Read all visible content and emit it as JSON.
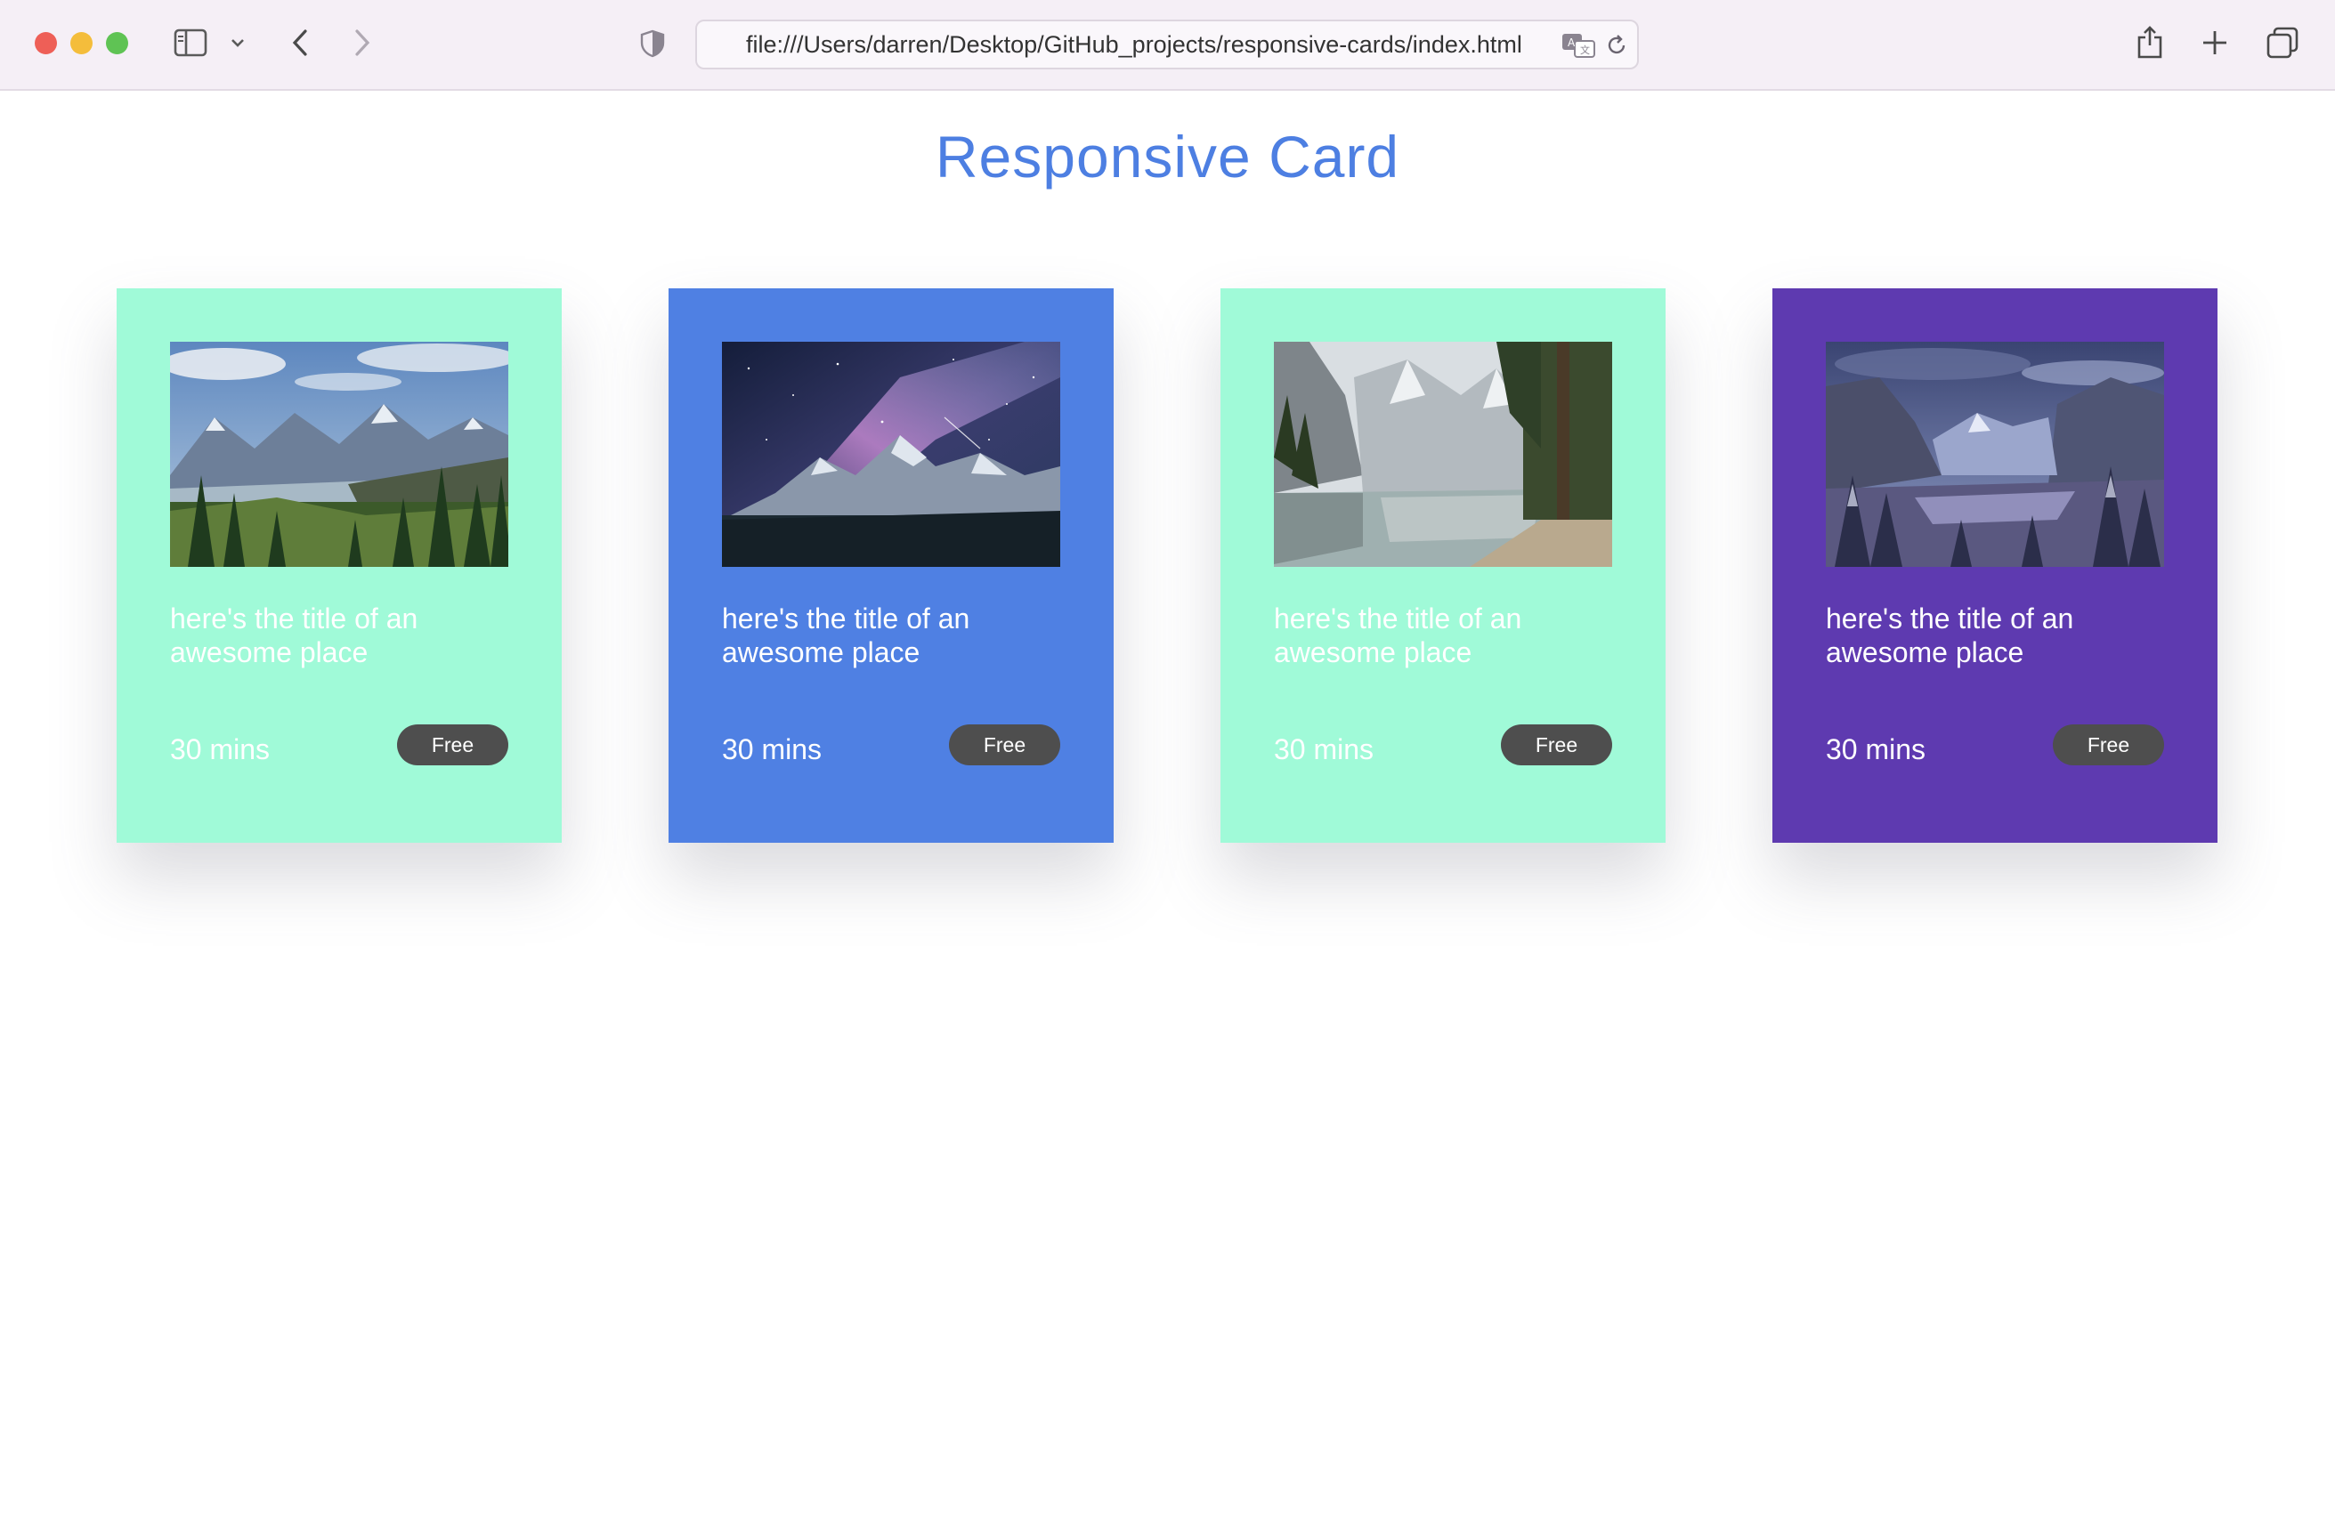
{
  "browser": {
    "url": "file:///Users/darren/Desktop/GitHub_projects/responsive-cards/index.html",
    "icons": [
      "close-window-icon",
      "minimize-window-icon",
      "maximize-window-icon",
      "sidebar-icon",
      "chevron-down-icon",
      "back-icon",
      "forward-icon",
      "privacy-shield-icon",
      "translate-icon",
      "reload-icon",
      "share-icon",
      "new-tab-icon",
      "tab-overview-icon"
    ]
  },
  "page": {
    "title": "Responsive Card"
  },
  "cards": [
    {
      "title": "here's the title of an awesome place",
      "time": "30 mins",
      "badge": "Free",
      "bg": "#a0fad8",
      "image": "mountain-valley-forest-photo"
    },
    {
      "title": "here's the title of an awesome place",
      "time": "30 mins",
      "badge": "Free",
      "bg": "#4f80e3",
      "image": "night-sky-milky-way-mountains-photo"
    },
    {
      "title": "here's the title of an awesome place",
      "time": "30 mins",
      "badge": "Free",
      "bg": "#a0fad8",
      "image": "alpine-lake-reflection-photo"
    },
    {
      "title": "here's the title of an awesome place",
      "time": "30 mins",
      "badge": "Free",
      "bg": "#5e3ab0",
      "image": "snowy-valley-winter-photo"
    }
  ]
}
